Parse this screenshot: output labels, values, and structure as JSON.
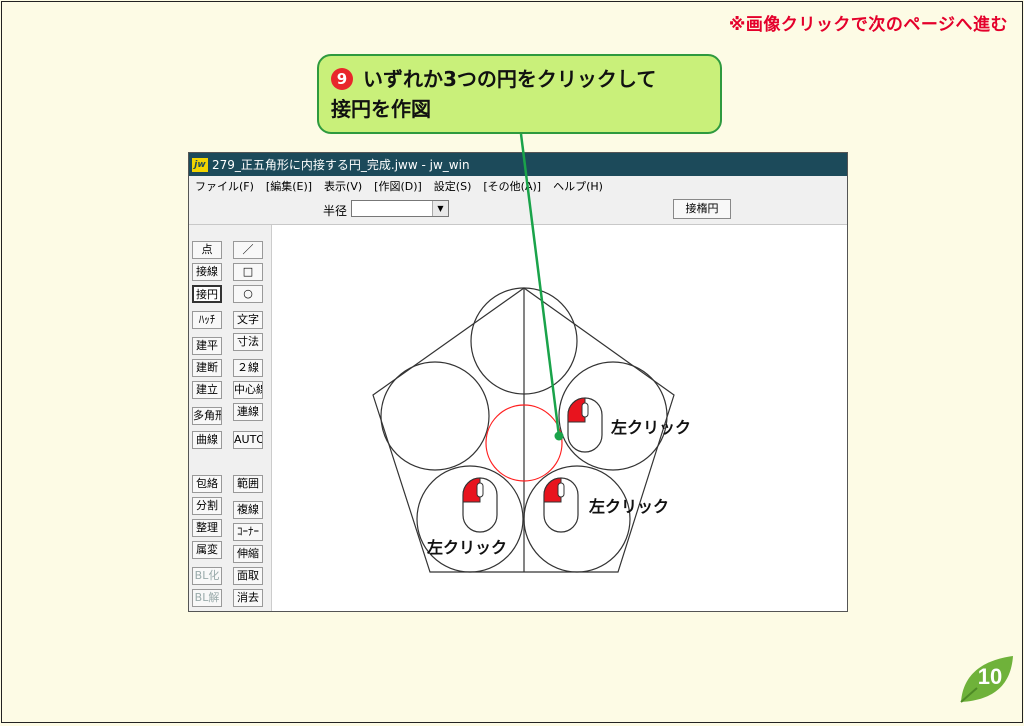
{
  "header": {
    "note": "※画像クリックで次のページへ進む"
  },
  "callout": {
    "step": "9",
    "text_line1": "いずれか3つの円をクリックして",
    "text_line2": "接円を作図"
  },
  "window": {
    "title": "279_正五角形に内接する円_完成.jww - jw_win",
    "icon_text": "jw",
    "menu": [
      "ファイル(F)",
      "[編集(E)]",
      "表示(V)",
      "[作図(D)]",
      "設定(S)",
      "[その他(A)]",
      "ヘルプ(H)"
    ],
    "toolbar": {
      "radius_label": "半径",
      "radius_value": "",
      "tangent_ellipse_label": "接楕円"
    },
    "tools_left": [
      "点",
      "接線",
      "接円",
      "ﾊｯﾁ",
      "建平",
      "建断",
      "建立",
      "多角形",
      "曲線",
      "包絡",
      "分割",
      "整理",
      "属変",
      "BL化",
      "BL解"
    ],
    "tools_right": [
      "／",
      "□",
      "○",
      "文字",
      "寸法",
      "２線",
      "中心線",
      "連線",
      "AUTO",
      "範囲",
      "複線",
      "ｺｰﾅｰ",
      "伸縮",
      "面取",
      "消去"
    ],
    "active_tool": "接円",
    "disabled_tools": [
      "BL化",
      "BL解"
    ]
  },
  "labels": {
    "left_click_1": "左クリック",
    "left_click_2": "左クリック",
    "left_click_3": "左クリック"
  },
  "page_number": "10",
  "colors": {
    "callout_bg": "#c9f07a",
    "callout_border": "#2e9a3e",
    "note_red": "#e4002b",
    "title_bar": "#1c4a5a",
    "construction_circle": "#ff2020",
    "badge_green": "#6fb23a"
  }
}
